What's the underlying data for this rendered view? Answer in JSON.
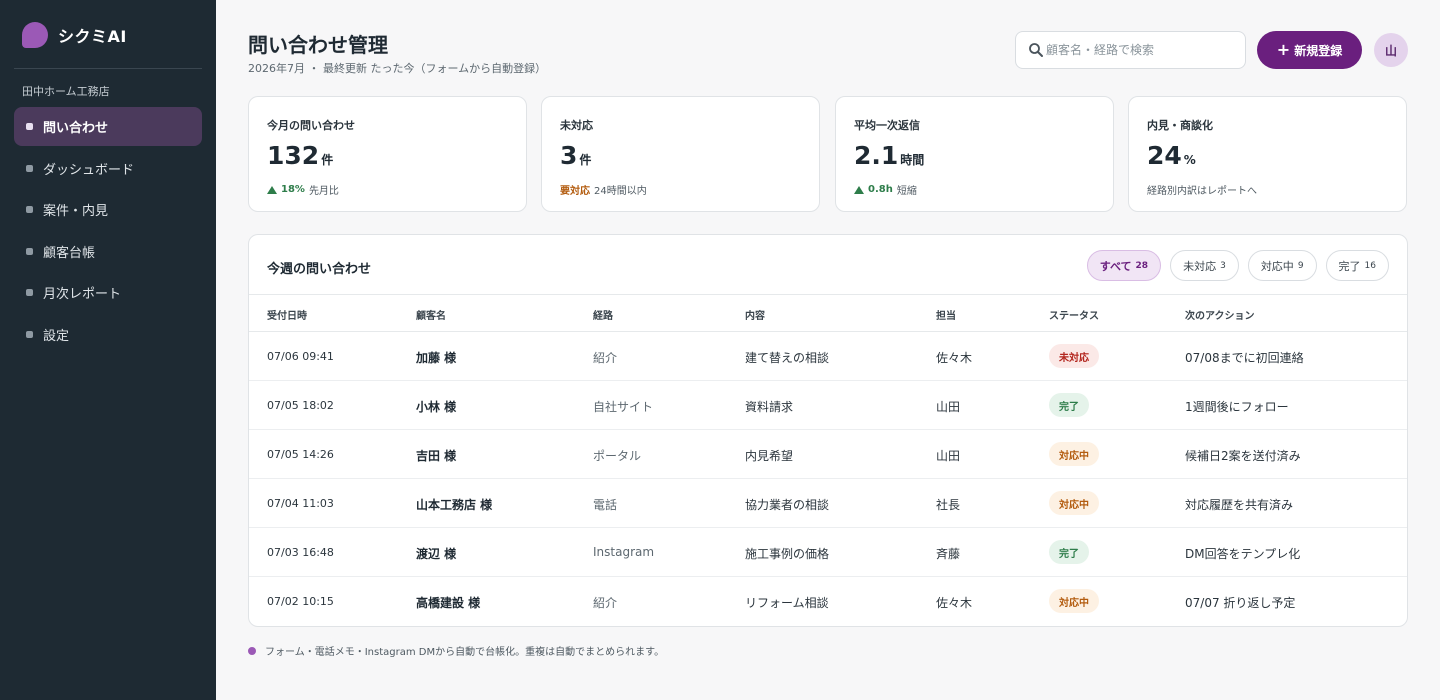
{
  "app": {
    "name": "シクミAI",
    "brand_color": "#9b59b6",
    "accent": "#6a1f7e"
  },
  "sidebar": {
    "company": "田中ホーム工務店",
    "items": [
      {
        "label": "問い合わせ",
        "active": true
      },
      {
        "label": "ダッシュボード",
        "active": false
      },
      {
        "label": "案件・内見",
        "active": false
      },
      {
        "label": "顧客台帳",
        "active": false
      },
      {
        "label": "月次レポート",
        "active": false
      },
      {
        "label": "設定",
        "active": false
      }
    ]
  },
  "header": {
    "title": "問い合わせ管理",
    "subtitle": "2026年7月 ・ 最終更新 たった今（フォームから自動登録）",
    "search_placeholder": "顧客名・経路で検索",
    "search_icon": "search-icon",
    "new_button": "新規登録",
    "avatar": "山"
  },
  "stats": [
    {
      "label": "今月の問い合わせ",
      "value": "132",
      "unit": "件",
      "delta": "18%",
      "note": "先月比",
      "trend": "up"
    },
    {
      "label": "未対応",
      "value": "3",
      "unit": "件",
      "flag": "要対応",
      "note": "24時間以内"
    },
    {
      "label": "平均一次返信",
      "value": "2.1",
      "unit": "時間",
      "delta": "0.8h",
      "note": "短縮",
      "trend": "up"
    },
    {
      "label": "内見・商談化",
      "value": "24",
      "unit": "%",
      "note": "経路別内訳はレポートへ"
    }
  ],
  "table": {
    "title": "今週の問い合わせ",
    "filters": [
      {
        "label": "すべて",
        "count": "28",
        "active": true
      },
      {
        "label": "未対応",
        "count": "3",
        "active": false
      },
      {
        "label": "対応中",
        "count": "9",
        "active": false
      },
      {
        "label": "完了",
        "count": "16",
        "active": false
      }
    ],
    "columns": [
      "受付日時",
      "顧客名",
      "経路",
      "内容",
      "担当",
      "ステータス",
      "次のアクション"
    ],
    "rows": [
      {
        "date": "07/06 09:41",
        "name": "加藤 様",
        "route": "紹介",
        "content": "建て替えの相談",
        "owner": "佐々木",
        "status": "未対応",
        "status_type": "open",
        "next": "07/08までに初回連絡"
      },
      {
        "date": "07/05 18:02",
        "name": "小林 様",
        "route": "自社サイト",
        "content": "資料請求",
        "owner": "山田",
        "status": "完了",
        "status_type": "done",
        "next": "1週間後にフォロー"
      },
      {
        "date": "07/05 14:26",
        "name": "吉田 様",
        "route": "ポータル",
        "content": "内見希望",
        "owner": "山田",
        "status": "対応中",
        "status_type": "prog",
        "next": "候補日2案を送付済み"
      },
      {
        "date": "07/04 11:03",
        "name": "山本工務店 様",
        "route": "電話",
        "content": "協力業者の相談",
        "owner": "社長",
        "status": "対応中",
        "status_type": "prog",
        "next": "対応履歴を共有済み"
      },
      {
        "date": "07/03 16:48",
        "name": "渡辺 様",
        "route": "Instagram",
        "content": "施工事例の価格",
        "owner": "斉藤",
        "status": "完了",
        "status_type": "done",
        "next": "DM回答をテンプレ化"
      },
      {
        "date": "07/02 10:15",
        "name": "高橋建設 様",
        "route": "紹介",
        "content": "リフォーム相談",
        "owner": "佐々木",
        "status": "対応中",
        "status_type": "prog",
        "next": "07/07 折り返し予定"
      }
    ]
  },
  "footnote": "フォーム・電話メモ・Instagram DMから自動で台帳化。重複は自動でまとめられます。"
}
